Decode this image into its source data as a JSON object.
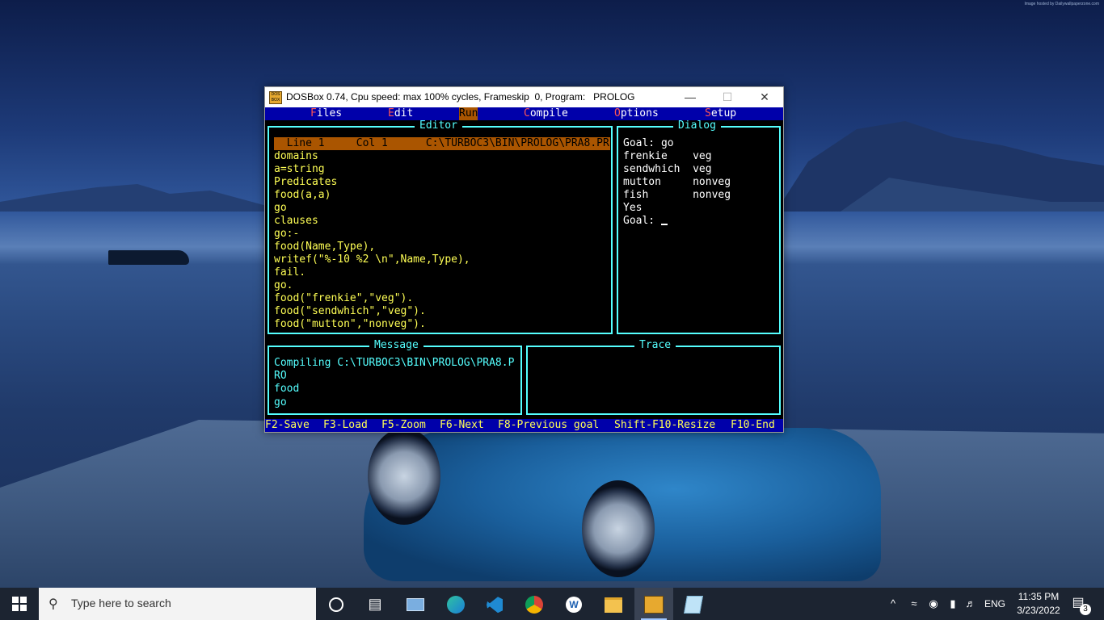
{
  "window": {
    "title": "DOSBox 0.74, Cpu speed: max 100% cycles, Frameskip  0, Program:   PROLOG",
    "icon_text": "DOS BOX",
    "controls": {
      "minimize": "—",
      "maximize": "☐",
      "close": "✕"
    }
  },
  "menu": [
    {
      "hot": "F",
      "rest": "iles"
    },
    {
      "hot": "E",
      "rest": "dit"
    },
    {
      "hot": "R",
      "rest": "un"
    },
    {
      "hot": "C",
      "rest": "ompile"
    },
    {
      "hot": "O",
      "rest": "ptions"
    },
    {
      "hot": "S",
      "rest": "etup"
    }
  ],
  "editor": {
    "title": "Editor",
    "status": "  Line 1     Col 1      C:\\TURBOC3\\BIN\\PROLOG\\PRA8.PR",
    "lines": [
      "domains",
      "a=string",
      "Predicates",
      "food(a,a)",
      "go",
      "clauses",
      "go:-",
      "food(Name,Type),",
      "writef(\"%-10 %2 \\n\",Name,Type),",
      "fail.",
      "go.",
      "food(\"frenkie\",\"veg\").",
      "food(\"sendwhich\",\"veg\").",
      "food(\"mutton\",\"nonveg\")."
    ]
  },
  "dialog": {
    "title": "Dialog",
    "lines": [
      "Goal: go",
      "frenkie    veg",
      "sendwhich  veg",
      "mutton     nonveg",
      "fish       nonveg",
      "Yes",
      "Goal: "
    ]
  },
  "message": {
    "title": "Message",
    "lines": [
      "Compiling C:\\TURBOC3\\BIN\\PROLOG\\PRA8.P",
      "RO",
      "food",
      "go"
    ]
  },
  "trace": {
    "title": "Trace"
  },
  "fkeys": [
    "F2-Save",
    "F3-Load",
    "F5-Zoom",
    "F6-Next",
    "F8-Previous goal",
    "Shift-F10-Resize",
    "F10-End"
  ],
  "taskbar": {
    "search_placeholder": "Type here to search",
    "language": "ENG",
    "time": "11:35 PM",
    "date": "3/23/2022",
    "notification_count": "3"
  },
  "wallpaper": {
    "watermark": "Image hosted by Dailywallpaperzone.com"
  }
}
